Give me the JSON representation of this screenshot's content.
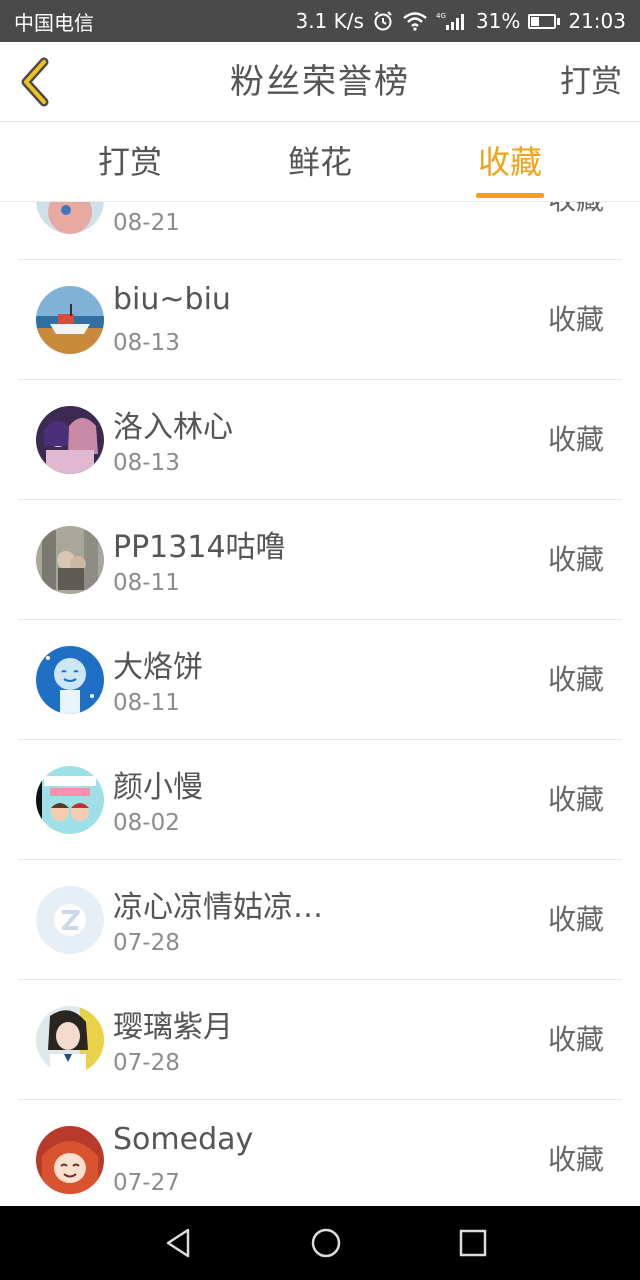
{
  "status_bar": {
    "carrier": "中国电信",
    "net_speed": "3.1 K/s",
    "network_type": "4G",
    "battery": "31%",
    "battery_level": 0.31,
    "time": "21:03",
    "icons": [
      "alarm-icon",
      "wifi-icon",
      "signal-icon",
      "battery-icon"
    ]
  },
  "header": {
    "title": "粉丝荣誉榜",
    "action_label": "打赏",
    "back_icon": "chevron-left-icon"
  },
  "tabs": [
    {
      "label": "打赏",
      "active": false
    },
    {
      "label": "鲜花",
      "active": false
    },
    {
      "label": "收藏",
      "active": true
    }
  ],
  "accent_color": "#f0a316",
  "list": [
    {
      "name": "",
      "date": "08-21",
      "kind": "收藏",
      "avatar": "avatar-partial"
    },
    {
      "name": "biu~biu",
      "date": "08-13",
      "kind": "收藏",
      "avatar": "boat-avatar"
    },
    {
      "name": "洛入林心",
      "date": "08-13",
      "kind": "收藏",
      "avatar": "anime-couple-avatar"
    },
    {
      "name": "PP1314咕噜",
      "date": "08-11",
      "kind": "收藏",
      "avatar": "photo-avatar"
    },
    {
      "name": "大烙饼",
      "date": "08-11",
      "kind": "收藏",
      "avatar": "blue-face-avatar"
    },
    {
      "name": "颜小慢",
      "date": "08-02",
      "kind": "收藏",
      "avatar": "cartoon-avatar"
    },
    {
      "name": "凉心凉情姑凉…",
      "date": "07-28",
      "kind": "收藏",
      "avatar": "default-qq-avatar"
    },
    {
      "name": "璎璃紫月",
      "date": "07-28",
      "kind": "收藏",
      "avatar": "girl-avatar"
    },
    {
      "name": "Someday",
      "date": "07-27",
      "kind": "收藏",
      "avatar": "red-hair-avatar"
    }
  ],
  "nav_bar": {
    "icons": [
      "back-triangle-icon",
      "home-circle-icon",
      "recents-square-icon"
    ]
  }
}
